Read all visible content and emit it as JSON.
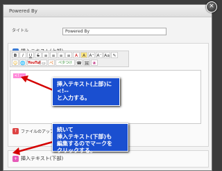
{
  "dialog": {
    "title": "Powered By",
    "close_glyph": "×"
  },
  "form": {
    "title_label": "タイトル",
    "title_value": "Powered By"
  },
  "top_section": {
    "header": "挿入テキスト(上部)",
    "editor_content": "<!--",
    "upload_label": "ファイルのアップロード"
  },
  "bottom_section": {
    "header": "挿入テキスト(下部)"
  },
  "toolbar": {
    "row1": [
      "B",
      "I",
      "U",
      "S",
      "≡",
      "≡",
      "≡",
      "≡",
      "A",
      "A",
      "A⁺",
      "A⁻",
      "Aa",
      "✎"
    ],
    "row2": [
      "☺",
      "🌐",
      "YouTube",
      "▭",
      "ぺ",
      "ペタつけ",
      "☎",
      "🖼",
      "❀"
    ]
  },
  "callouts": {
    "first": "挿入テキスト(上部)に\n<!--\nと入力する。",
    "second": "続いて\n挿入テキスト(下部)も\n編集するのでマークを\nクリックする。"
  },
  "colors": {
    "callout_bg": "#1a4fd0",
    "arrow": "#d40000",
    "highlight": "#ff88d8"
  }
}
